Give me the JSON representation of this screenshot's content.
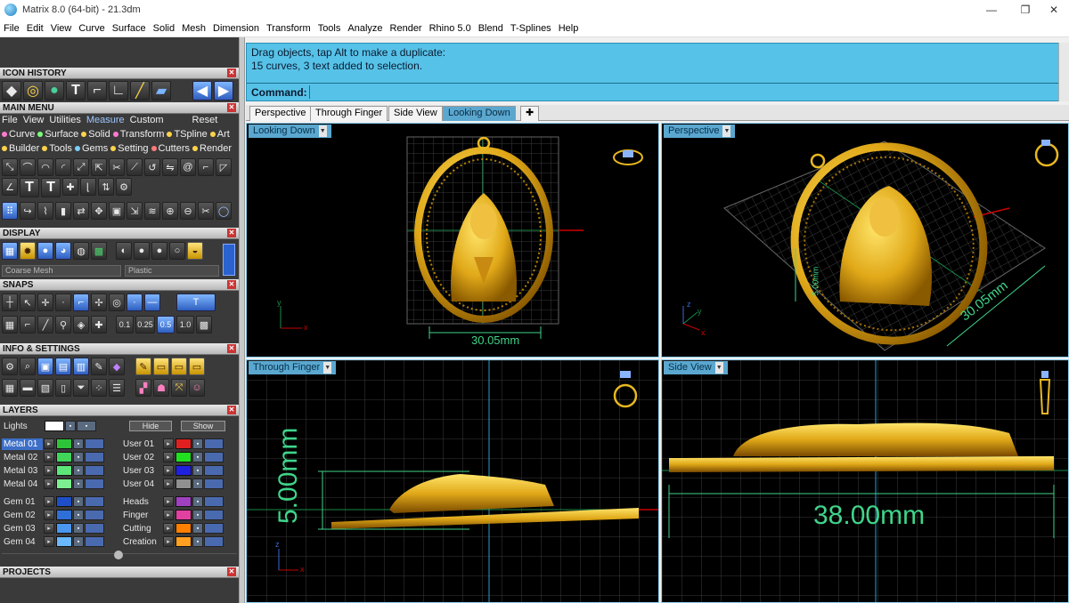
{
  "window": {
    "title": "Matrix 8.0 (64-bit) - 21.3dm",
    "controls": {
      "minimize": "—",
      "maximize": "❐",
      "close": "✕"
    }
  },
  "menubar": [
    "File",
    "Edit",
    "View",
    "Curve",
    "Surface",
    "Solid",
    "Mesh",
    "Dimension",
    "Transform",
    "Tools",
    "Analyze",
    "Render",
    "Rhino 5.0",
    "Blend",
    "T-Splines",
    "Help"
  ],
  "panels": {
    "icon_history": "ICON HISTORY",
    "main_menu": "MAIN MENU",
    "display": "DISPLAY",
    "snaps": "SNAPS",
    "info_settings": "INFO & SETTINGS",
    "layers": "LAYERS",
    "projects": "PROJECTS",
    "close_glyph": "✕"
  },
  "main_menu": {
    "top_row": [
      "File",
      "View",
      "Utilities",
      "Measure",
      "Custom"
    ],
    "reset": "Reset",
    "row1": [
      {
        "label": "Curve",
        "color": "#ff7ad0"
      },
      {
        "label": "Surface",
        "color": "#7aff7a"
      },
      {
        "label": "Solid",
        "color": "#ffd24a"
      },
      {
        "label": "Transform",
        "color": "#ff7ad0"
      },
      {
        "label": "TSpline",
        "color": "#ffd24a"
      },
      {
        "label": "Art",
        "color": "#ffd24a"
      }
    ],
    "row2": [
      {
        "label": "Builder",
        "color": "#ffd24a"
      },
      {
        "label": "Tools",
        "color": "#ffd24a"
      },
      {
        "label": "Gems",
        "color": "#7ad0ff"
      },
      {
        "label": "Setting",
        "color": "#ffd24a"
      },
      {
        "label": "Cutters",
        "color": "#ff7a7a"
      },
      {
        "label": "Render",
        "color": "#ffd24a"
      }
    ]
  },
  "display": {
    "mesh_select": "Coarse Mesh",
    "material_select": "Plastic"
  },
  "snaps": {
    "values": [
      "0.1",
      "0.25",
      "0.5",
      "1.0"
    ]
  },
  "layers": {
    "lights_label": "Lights",
    "hide_label": "Hide",
    "show_label": "Show",
    "left": [
      {
        "name": "Metal 01",
        "color": "#2ec43a",
        "selected": true
      },
      {
        "name": "Metal 02",
        "color": "#3fd65a"
      },
      {
        "name": "Metal 03",
        "color": "#5ce67a"
      },
      {
        "name": "Metal 04",
        "color": "#7cf090"
      },
      {
        "name": "Gem 01",
        "color": "#1f4fc8"
      },
      {
        "name": "Gem 02",
        "color": "#2f6fd8"
      },
      {
        "name": "Gem 03",
        "color": "#4a96f0"
      },
      {
        "name": "Gem 04",
        "color": "#6ab8ff"
      }
    ],
    "right": [
      {
        "name": "User 01",
        "color": "#e02020"
      },
      {
        "name": "User 02",
        "color": "#20e020"
      },
      {
        "name": "User 03",
        "color": "#2020e0"
      },
      {
        "name": "User 04",
        "color": "#909090"
      },
      {
        "name": "Heads",
        "color": "#a040c0"
      },
      {
        "name": "Finger",
        "color": "#e040a0"
      },
      {
        "name": "Cutting",
        "color": "#ff8000"
      },
      {
        "name": "Creation",
        "color": "#ffa020"
      }
    ]
  },
  "command": {
    "line1": "Drag objects, tap Alt to make a duplicate:",
    "line2": "15 curves, 3 text added to selection.",
    "label": "Command:"
  },
  "tabs": [
    {
      "label": "Perspective"
    },
    {
      "label": "Through Finger"
    },
    {
      "label": "Side View"
    },
    {
      "label": "Looking Down",
      "active": true
    },
    {
      "label": "✚"
    }
  ],
  "viewports": {
    "top_left": {
      "label": "Looking Down",
      "dimension": "30.05mm",
      "axis_x": "x",
      "axis_y": "y"
    },
    "top_right": {
      "label": "Perspective",
      "dimension": "30.05mm",
      "dimension2": "5.00mm",
      "axis_x": "x",
      "axis_y": "y",
      "axis_z": "z"
    },
    "bottom_left": {
      "label": "Through Finger",
      "dimension": "5.00mm",
      "axis_x": "x",
      "axis_z": "z"
    },
    "bottom_right": {
      "label": "Side View",
      "dimension": "38.00mm"
    }
  },
  "colors": {
    "command_bg": "#57c2e8",
    "active_tab": "#5aa7cf",
    "gold": "#e8b820",
    "dimension_green": "#3fd58a",
    "viewport_bg": "#000000"
  }
}
